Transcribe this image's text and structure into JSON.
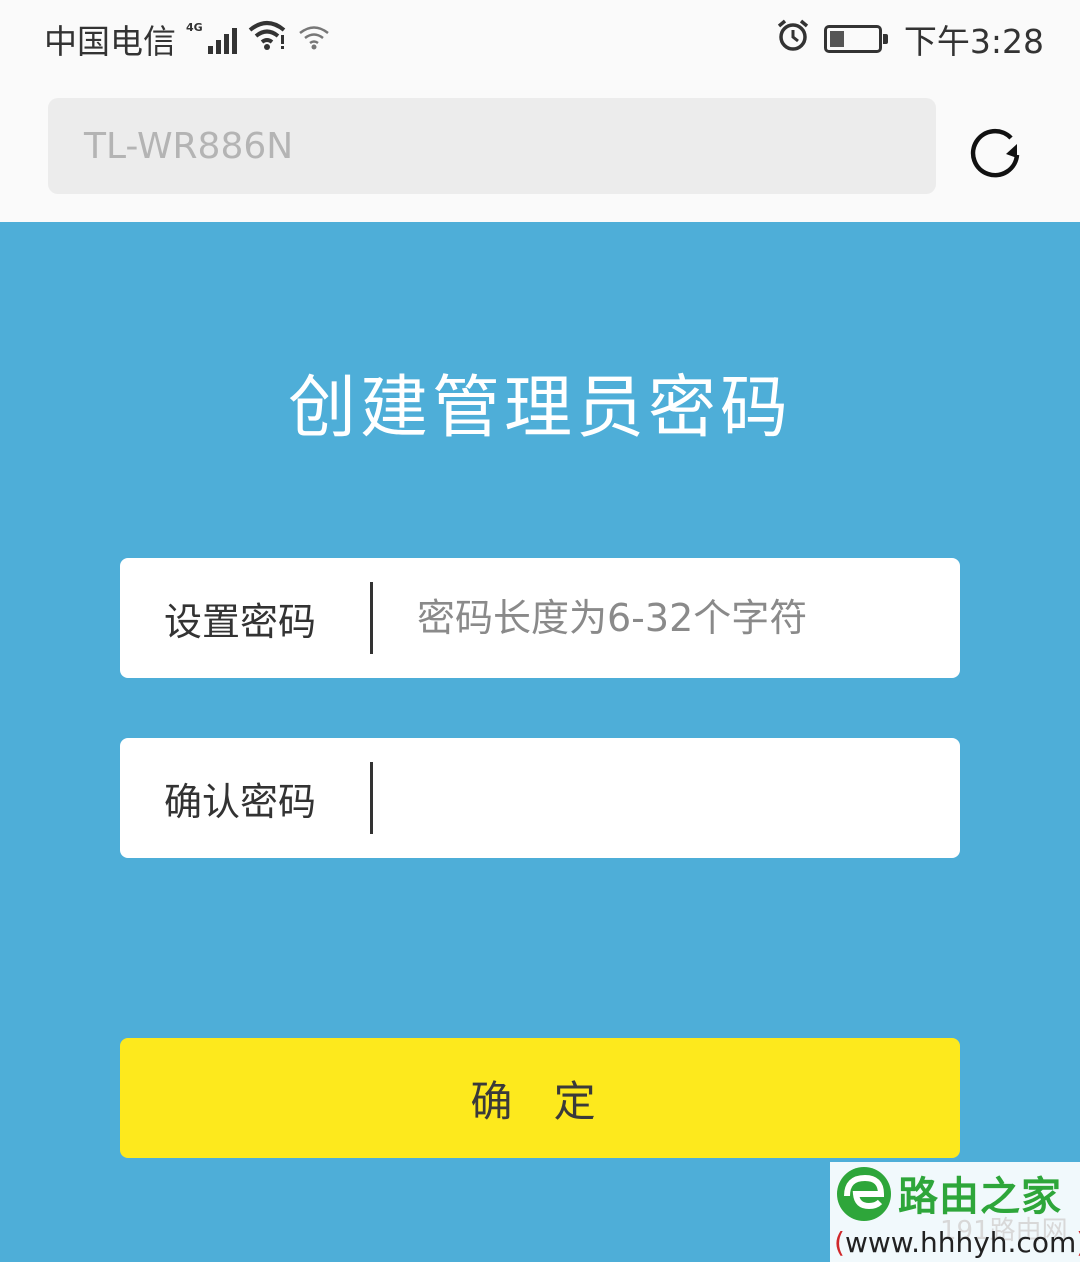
{
  "status_bar": {
    "carrier": "中国电信",
    "network_type": "4G",
    "time": "下午3:28",
    "icons": [
      "signal-icon",
      "wifi-icon",
      "wifi-secondary-icon",
      "alarm-icon",
      "battery-icon"
    ]
  },
  "address_bar": {
    "value": "TL-WR886N",
    "refresh_icon": "refresh-icon"
  },
  "page": {
    "title": "创建管理员密码",
    "password_label": "设置密码",
    "password_placeholder": "密码长度为6-32个字符",
    "confirm_label": "确认密码",
    "confirm_placeholder": "",
    "submit_label": "确 定"
  },
  "watermark": {
    "name": "路由之家",
    "sub": "191路由网",
    "url_open": "(",
    "url": "www.hhhyh.com",
    "url_close": ")"
  },
  "colors": {
    "background": "#4eaed8",
    "button": "#fde91d",
    "status_bar": "#fafafa"
  }
}
